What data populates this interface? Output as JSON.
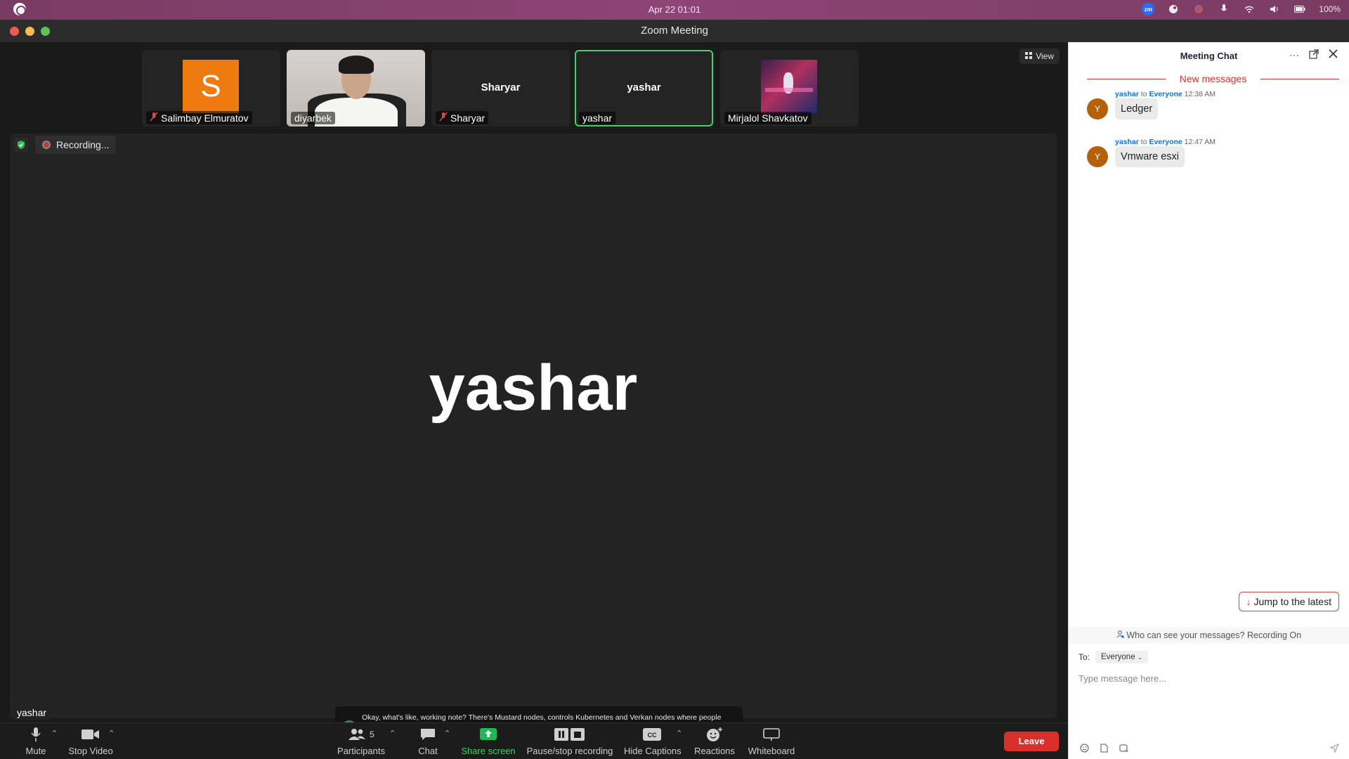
{
  "system": {
    "clock": "Apr 22  01:01",
    "battery": "100%"
  },
  "window": {
    "title": "Zoom Meeting"
  },
  "participants_strip": [
    {
      "name": "Salimbay Elmuratov",
      "avatar_letter": "S",
      "muted": true
    },
    {
      "name": "diyarbek",
      "muted": false
    },
    {
      "name": "Sharyar",
      "center_name": "Sharyar",
      "muted": true
    },
    {
      "name": "yashar",
      "center_name": "yashar",
      "active": true
    },
    {
      "name": "Mirjalol Shavkatov",
      "muted": false
    }
  ],
  "view_button": "View",
  "recording": {
    "label": "Recording..."
  },
  "stage": {
    "speaker_name": "yashar",
    "name_tag": "yashar"
  },
  "caption": {
    "avatar_letter": "Y",
    "text": "Okay, what's like, working note? There's Mustard nodes, controls Kubernetes and Verkan nodes where people deploy images and master Like, like it checks everything, there's everything in mustard note that is important and working notes they have"
  },
  "toolbar": {
    "mute": "Mute",
    "stop_video": "Stop Video",
    "participants": "Participants",
    "participants_count": "5",
    "chat": "Chat",
    "share_screen": "Share screen",
    "pause_stop_recording": "Pause/stop recording",
    "hide_captions": "Hide Captions",
    "reactions": "Reactions",
    "whiteboard": "Whiteboard",
    "leave": "Leave"
  },
  "chat": {
    "title": "Meeting Chat",
    "new_messages": "New messages",
    "messages": [
      {
        "sender": "yashar",
        "to_word": "to",
        "recipient": "Everyone",
        "time": "12:38 AM",
        "avatar_letter": "Y",
        "text": "Ledger"
      },
      {
        "sender": "yashar",
        "to_word": "to",
        "recipient": "Everyone",
        "time": "12:47 AM",
        "avatar_letter": "Y",
        "text": "Vmware esxi"
      }
    ],
    "jump_latest": "Jump to the latest",
    "who_can_see": "Who can see your messages? Recording On",
    "to_label": "To:",
    "to_value": "Everyone",
    "input_placeholder": "Type message here..."
  },
  "colors": {
    "accent_green": "#3fd26b",
    "leave_red": "#d9302b",
    "share_green": "#1db954",
    "link_blue": "#0e72ed"
  }
}
